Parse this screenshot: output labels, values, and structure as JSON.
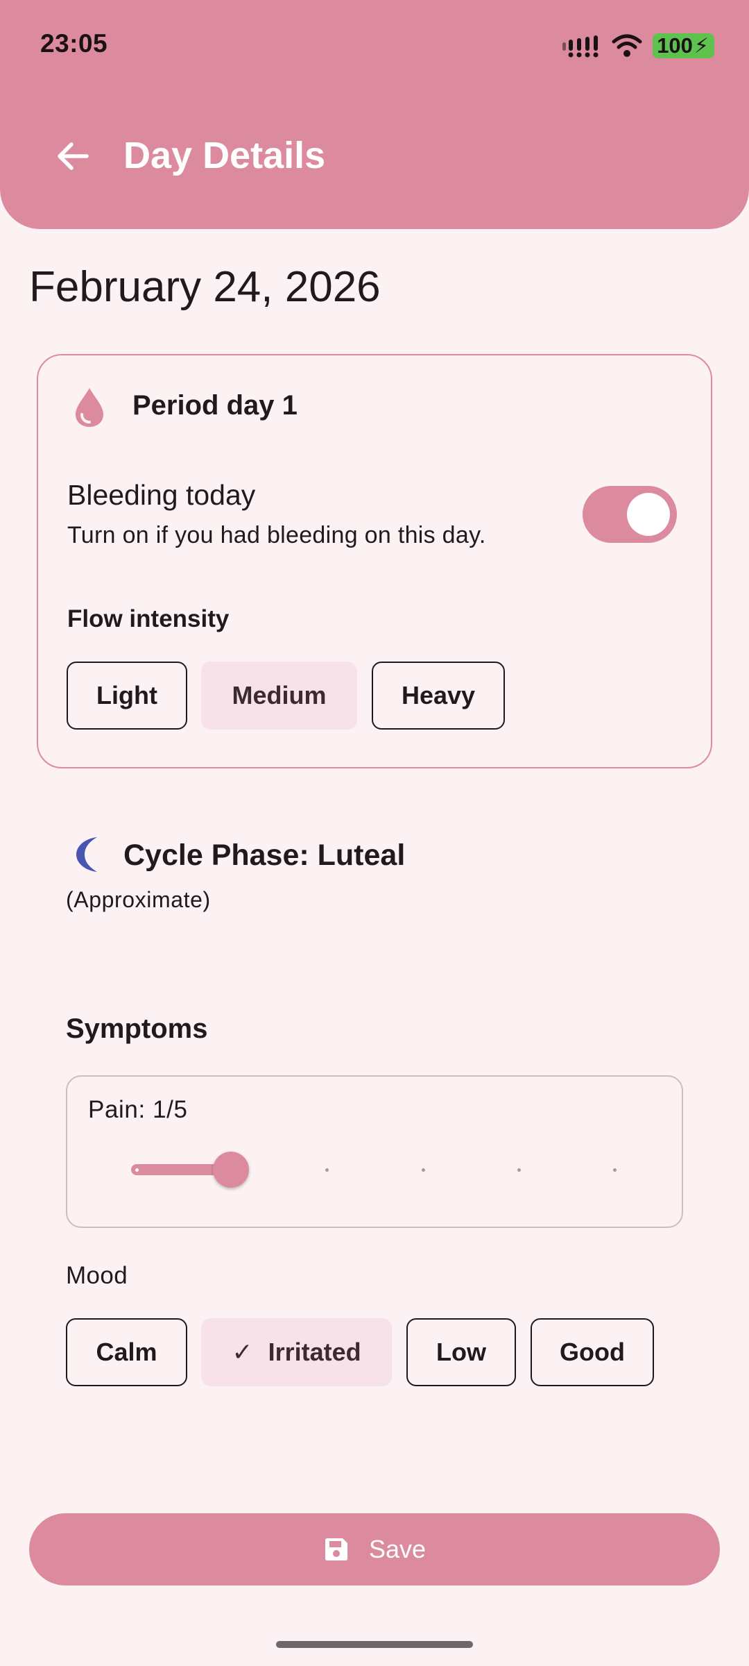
{
  "status_bar": {
    "time": "23:05",
    "battery": "100"
  },
  "app_bar": {
    "title": "Day Details"
  },
  "date": "February 24, 2026",
  "period": {
    "title": "Period day 1",
    "bleeding_title": "Bleeding today",
    "bleeding_subtitle": "Turn on if you had bleeding on this day.",
    "bleeding_on": true,
    "flow_label": "Flow intensity",
    "flow_options": [
      "Light",
      "Medium",
      "Heavy"
    ],
    "flow_selected": "Medium"
  },
  "cycle_phase": {
    "title": "Cycle Phase: Luteal",
    "subtitle": "(Approximate)"
  },
  "symptoms": {
    "title": "Symptoms",
    "pain_label": "Pain: 1/5",
    "pain_value": 1,
    "pain_max": 5
  },
  "mood": {
    "label": "Mood",
    "options": [
      "Calm",
      "Irritated",
      "Low",
      "Good"
    ],
    "selected": "Irritated"
  },
  "save_button": {
    "label": "Save"
  },
  "colors": {
    "accent": "#db8b9d",
    "background": "#fcf1f3",
    "chip_selected": "#f6e2e8",
    "moon": "#4a55b0"
  }
}
